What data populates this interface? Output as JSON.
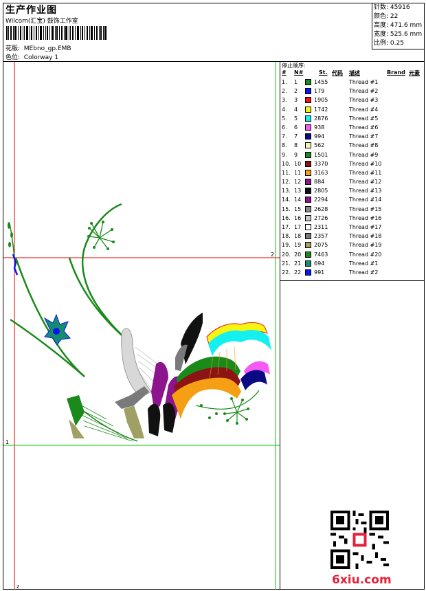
{
  "header": {
    "title": "生产作业图",
    "company": "Wilcom(汇宝) 鼓饰工作室",
    "design_label": "花版:",
    "design_file": "MEbno_gp.EMB",
    "colorway_label": "色位:",
    "colorway": "Colorway 1"
  },
  "stats": [
    {
      "label": "针数:",
      "value": "45916"
    },
    {
      "label": "颜色:",
      "value": "22"
    },
    {
      "label": "高度:",
      "value": "471.6 mm"
    },
    {
      "label": "宽度:",
      "value": "525.6 mm"
    },
    {
      "label": "比例:",
      "value": "0.25"
    }
  ],
  "canvas": {
    "marker_2": "2",
    "marker_1": "1",
    "marker_start": "z"
  },
  "stop_sequence": {
    "heading": "停止顺序:",
    "columns": {
      "num": "#",
      "needle": "N#",
      "stitches": "St.",
      "code": "代码",
      "desc": "描述",
      "brand": "Brand",
      "element": "元素"
    },
    "rows": [
      {
        "num": "1.",
        "needle": "1",
        "color": "#1a8a1a",
        "stitches": "1455",
        "desc": "Thread #1"
      },
      {
        "num": "2.",
        "needle": "2",
        "color": "#0a14f0",
        "stitches": "179",
        "desc": "Thread #2"
      },
      {
        "num": "3.",
        "needle": "3",
        "color": "#f01414",
        "stitches": "1905",
        "desc": "Thread #3"
      },
      {
        "num": "4.",
        "needle": "4",
        "color": "#f5f514",
        "stitches": "1742",
        "desc": "Thread #4"
      },
      {
        "num": "5.",
        "needle": "5",
        "color": "#14f0f0",
        "stitches": "2876",
        "desc": "Thread #5"
      },
      {
        "num": "6.",
        "needle": "6",
        "color": "#f55af5",
        "stitches": "938",
        "desc": "Thread #6"
      },
      {
        "num": "7.",
        "needle": "7",
        "color": "#0a0a82",
        "stitches": "994",
        "desc": "Thread #7"
      },
      {
        "num": "8.",
        "needle": "8",
        "color": "#f5f5b4",
        "stitches": "562",
        "desc": "Thread #8"
      },
      {
        "num": "9.",
        "needle": "9",
        "color": "#1a8a1a",
        "stitches": "1501",
        "desc": "Thread #9"
      },
      {
        "num": "10.",
        "needle": "10",
        "color": "#8c1414",
        "stitches": "3370",
        "desc": "Thread #10"
      },
      {
        "num": "11.",
        "needle": "11",
        "color": "#f5a014",
        "stitches": "3163",
        "desc": "Thread #11"
      },
      {
        "num": "12.",
        "needle": "12",
        "color": "#8c148c",
        "stitches": "884",
        "desc": "Thread #12"
      },
      {
        "num": "13.",
        "needle": "13",
        "color": "#111111",
        "stitches": "2805",
        "desc": "Thread #13"
      },
      {
        "num": "14.",
        "needle": "14",
        "color": "#8c148c",
        "stitches": "2294",
        "desc": "Thread #14"
      },
      {
        "num": "15.",
        "needle": "15",
        "color": "#8c8c8c",
        "stitches": "2628",
        "desc": "Thread #15"
      },
      {
        "num": "16.",
        "needle": "16",
        "color": "#c8c8c8",
        "stitches": "2726",
        "desc": "Thread #16"
      },
      {
        "num": "17.",
        "needle": "17",
        "color": "#ffffff",
        "stitches": "2311",
        "desc": "Thread #17"
      },
      {
        "num": "18.",
        "needle": "18",
        "color": "#7a7a7a",
        "stitches": "2357",
        "desc": "Thread #18"
      },
      {
        "num": "19.",
        "needle": "19",
        "color": "#a0a064",
        "stitches": "2075",
        "desc": "Thread #19"
      },
      {
        "num": "20.",
        "needle": "20",
        "color": "#1a8a1a",
        "stitches": "7463",
        "desc": "Thread #20"
      },
      {
        "num": "21.",
        "needle": "21",
        "color": "#148c6e",
        "stitches": "694",
        "desc": "Thread #1"
      },
      {
        "num": "22.",
        "needle": "22",
        "color": "#0a14f0",
        "stitches": "991",
        "desc": "Thread #2"
      }
    ]
  },
  "watermark": "6xiu.com",
  "icons": {
    "qr": "qr-code-icon",
    "seal": "seal-stamp-icon"
  }
}
